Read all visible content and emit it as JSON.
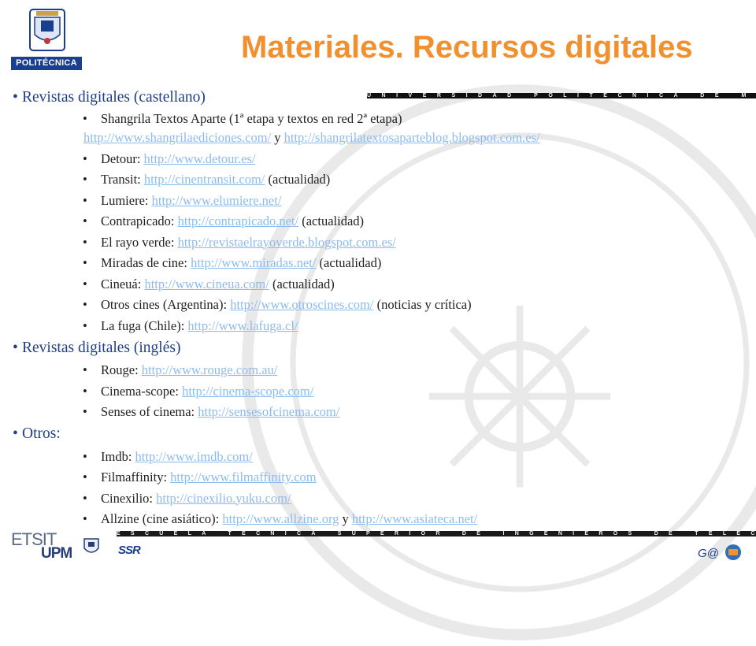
{
  "header": {
    "logo_text": "POLITÉCNICA",
    "title": "Materiales. Recursos digitales",
    "band_top": "UNIVERSIDAD POLITÉCNICA DE MADRID",
    "band_bottom": "ESCUELA TÉCNICA SUPERIOR DE INGENIEROS DE TELECOMUNICACIÓN"
  },
  "sections": {
    "s1": {
      "heading": "Revistas digitales (castellano)",
      "items": [
        {
          "text": "Shangrila Textos Aparte (1ª etapa y textos en red 2ª etapa)"
        },
        {
          "link": "http://www.shangrilaediciones.com/",
          "mid": " y ",
          "link2": "http://shangrilatextosaparteblog.blogspot.com.es/"
        },
        {
          "text": "Detour: ",
          "link": "http://www.detour.es/"
        },
        {
          "text": "Transit: ",
          "link": "http://cinentransit.com/",
          "suffix": " (actualidad)"
        },
        {
          "text": "Lumiere: ",
          "link": "http://www.elumiere.net/"
        },
        {
          "text": "Contrapicado: ",
          "link": "http://contrapicado.net/",
          "suffix": " (actualidad)"
        },
        {
          "text": "El rayo verde: ",
          "link": "http://revistaelrayoverde.blogspot.com.es/"
        },
        {
          "text": "Miradas de cine: ",
          "link": " http://www.miradas.net/",
          "suffix": " (actualidad)"
        },
        {
          "text": "Cineuá: ",
          "link": "http://www.cineua.com/",
          "suffix": " (actualidad)"
        },
        {
          "text": "Otros cines (Argentina): ",
          "link": "http://www.otroscines.com/",
          "suffix": "  (noticias y crítica)"
        },
        {
          "text": "La fuga (Chile): ",
          "link": "http://www.lafuga.cl/"
        }
      ]
    },
    "s2": {
      "heading": "Revistas digitales (inglés)",
      "items": [
        {
          "text": "Rouge: ",
          "link": "http://www.rouge.com.au/"
        },
        {
          "text": "Cinema-scope: ",
          "link": "http://cinema-scope.com/"
        },
        {
          "text": "Senses of cinema: ",
          "link": "http://sensesofcinema.com/"
        }
      ]
    },
    "s3": {
      "heading": "Otros:",
      "items": [
        {
          "text": "Imdb: ",
          "link": "http://www.imdb.com/"
        },
        {
          "text": "Filmaffinity: ",
          "link": "http://www.filmaffinity.com"
        },
        {
          "text": "Cinexilio: ",
          "link": "http://cinexilio.yuku.com/"
        },
        {
          "text": "Allzine (cine asiático): ",
          "link": "http://www.allzine.org",
          "mid": " y ",
          "link2": "http://www.asiateca.net/"
        }
      ]
    }
  },
  "footer": {
    "etsit": "ETSIT",
    "upm": "UPM",
    "ssr": "SSR",
    "gtv": "G@"
  },
  "colors": {
    "title": "#f0902f",
    "heading": "#1f3f86",
    "link": "#8cbcee",
    "band": "#101010"
  }
}
